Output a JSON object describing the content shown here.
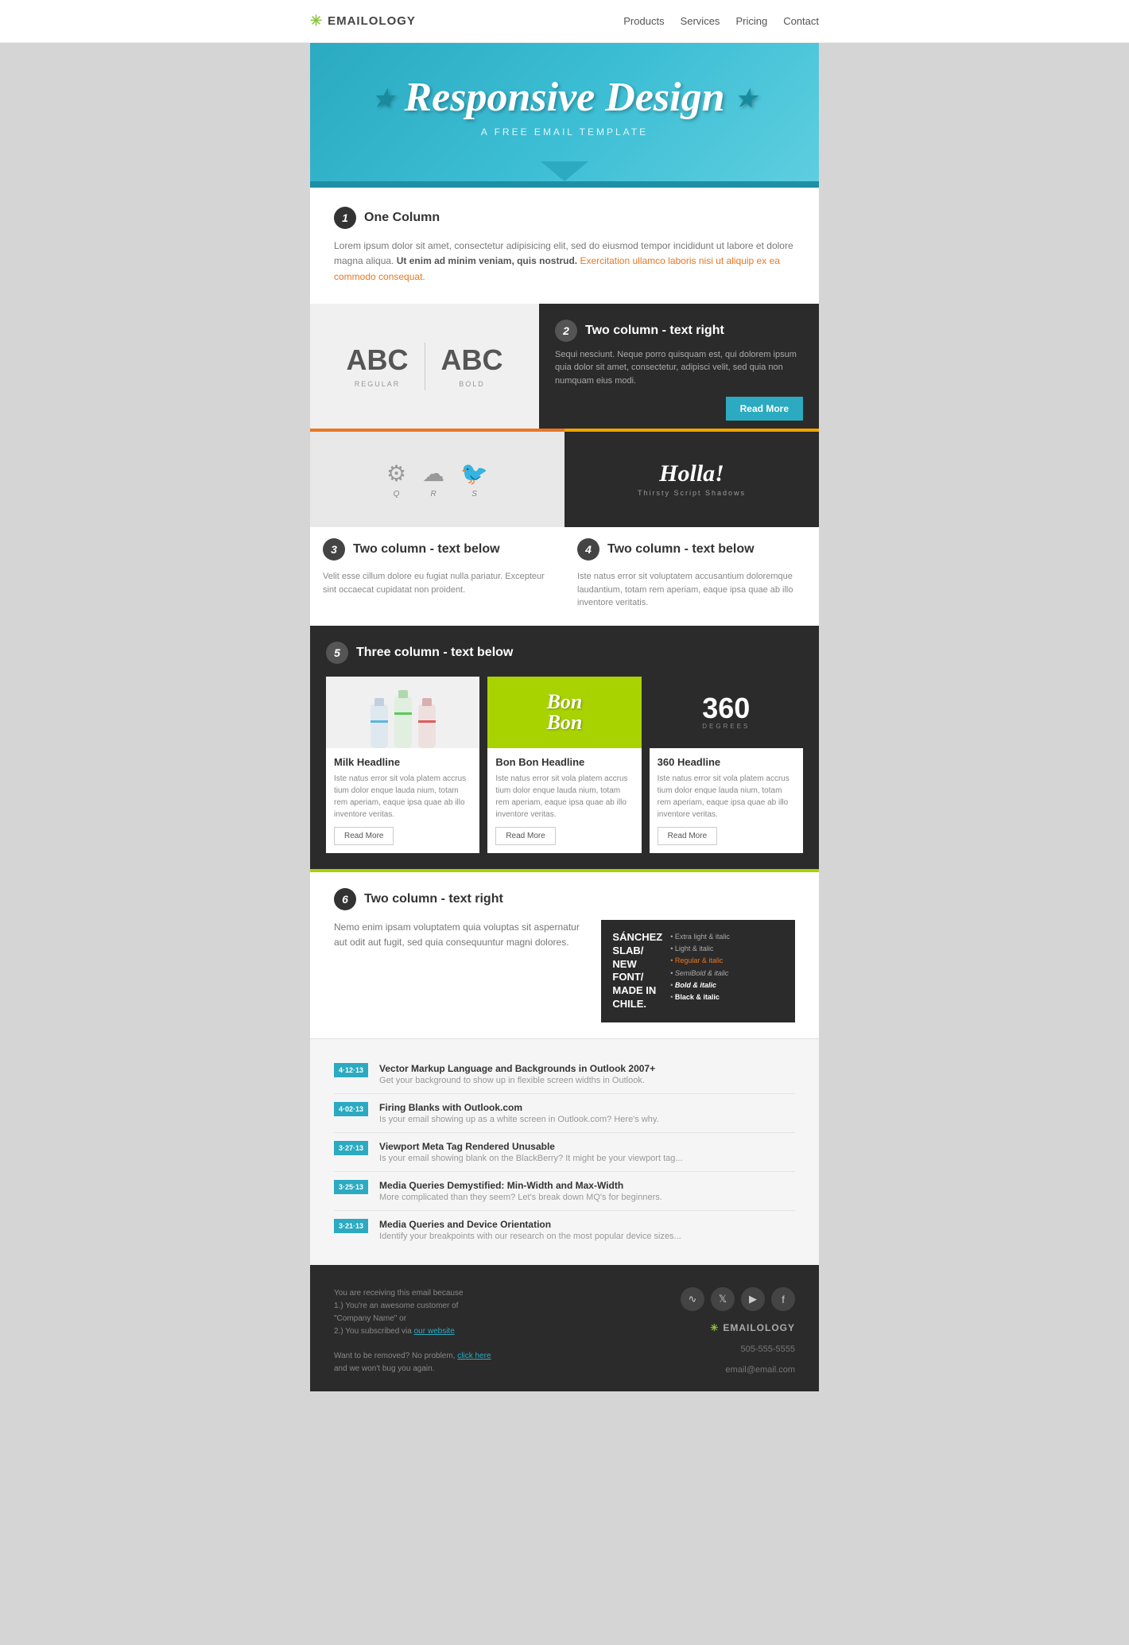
{
  "nav": {
    "logo": "EMAILOLOGY",
    "links": [
      "Products",
      "Services",
      "Pricing",
      "Contact"
    ]
  },
  "hero": {
    "title": "Responsive Design",
    "subtitle": "A FREE EMAIL TEMPLATE",
    "star_left": "★",
    "star_right": "★"
  },
  "section1": {
    "num": "1",
    "title": "One Column",
    "body": "Lorem ipsum dolor sit amet, consectetur adipisicing elit, sed do eiusmod tempor incididunt ut labore et dolore magna aliqua.",
    "bold_text": "Ut enim ad minim veniam, quis nostrud.",
    "highlight_text": "Exercitation ullamco laboris nisi ut aliquip ex ea commodo consequat."
  },
  "section2": {
    "num": "2",
    "title": "Two column - text right",
    "body": "Sequi nesciunt. Neque porro quisquam est, qui dolorem ipsum quia dolor sit amet, consectetur, adipisci velit, sed quia non numquam eius modi.",
    "abc_left_label": "REGULAR",
    "abc_right_label": "BOLD",
    "read_more": "Read More"
  },
  "section3": {
    "num": "3",
    "title": "Two column - text below",
    "body": "Velit esse cillum dolore eu fugiat nulla pariatur. Excepteur sint occaecat cupidatat non proident."
  },
  "section4": {
    "num": "4",
    "title": "Two column - text below",
    "body": "Iste natus error sit voluptatem accusantium doloremque laudantium, totam rem aperiam, eaque ipsa quae ab illo inventore veritatis."
  },
  "section5": {
    "num": "5",
    "title": "Three column - text below",
    "col1": {
      "headline": "Milk Headline",
      "text": "Iste natus error sit vola platem accrus tium dolor enque lauda nium, totam rem aperiam, eaque ipsa quae ab illo inventore veritas.",
      "read_more": "Read More"
    },
    "col2": {
      "headline": "Bon Bon Headline",
      "text": "Iste natus error sit vola platem accrus tium dolor enque lauda nium, totam rem aperiam, eaque ipsa quae ab illo inventore veritas.",
      "read_more": "Read More"
    },
    "col3": {
      "headline": "360 Headline",
      "text": "Iste natus error sit vola platem accrus tium dolor enque lauda nium, totam rem aperiam, eaque ipsa quae ab illo inventore veritas.",
      "read_more": "Read More"
    }
  },
  "section6": {
    "num": "6",
    "title": "Two column - text right",
    "body": "Nemo enim ipsam voluptatem quia voluptas sit aspernatur aut odit aut fugit, sed quia consequuntur magni dolores.",
    "sanchez_main": "SÁNCHEZ\nSLAB/\nNEW\nFONT/\nMADE IN\nCHILE.",
    "sanchez_list": [
      "Extra light & italic",
      "Light & italic",
      "Regular & italic",
      "SemiBold & italic",
      "Bold & italic",
      "Black & italic"
    ]
  },
  "blog": {
    "items": [
      {
        "date": "4·12·13",
        "title": "Vector Markup Language and Backgrounds in Outlook 2007+",
        "desc": "Get your background to show up in flexible screen widths in Outlook."
      },
      {
        "date": "4·02·13",
        "title": "Firing Blanks with Outlook.com",
        "desc": "Is your email showing up as a white screen in Outlook.com? Here's why."
      },
      {
        "date": "3·27·13",
        "title": "Viewport Meta Tag Rendered Unusable",
        "desc": "Is your email showing blank on the BlackBerry? It might be your viewport tag..."
      },
      {
        "date": "3·25·13",
        "title": "Media Queries Demystified: Min-Width and Max-Width",
        "desc": "More complicated than they seem? Let's break down MQ's for beginners."
      },
      {
        "date": "3·21·13",
        "title": "Media Queries and Device Orientation",
        "desc": "Identify your breakpoints with our research on the most popular device sizes..."
      }
    ]
  },
  "footer": {
    "notice_text": "You are receiving this email because\n1.) You're an awesome customer of \"Company Name\" or\n2.) You subscribed via",
    "our_website": "our website",
    "remove_text": "Want to be removed? No problem,",
    "click_here": "click here",
    "remove_text2": "and we won't bug you again.",
    "logo": "EMAILOLOGY",
    "phone": "505-555-5555",
    "email": "email@email.com",
    "social_icons": [
      "rss",
      "twitter",
      "vimeo",
      "facebook"
    ]
  },
  "colors": {
    "teal": "#2baac1",
    "orange": "#e87722",
    "green": "#a8d200",
    "dark": "#2b2b2b",
    "light_gray": "#f5f5f5"
  }
}
